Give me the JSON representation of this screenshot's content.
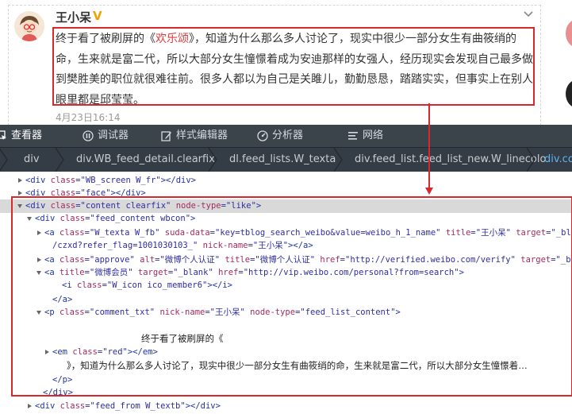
{
  "feed": {
    "username": "王小呆",
    "v_badge": "V",
    "post_prefix": "终于看了被刷屏的《",
    "post_highlight": "欢乐颂",
    "post_suffix": "》，知道为什么那么多人讨论了，现实中很少一部分女生有曲筱绡的命，生来就是富二代，所以大部分女生憧憬着成为安迪那样的女强人，经历现实会发现自己最多做到樊胜美的职位就很难往前。很多人都以为自己是关雎儿，勤勤恳恳，踏踏实实，但事实上在别人眼里都是邱莹莹。",
    "date": "4月23日16:14"
  },
  "devtools": {
    "tabs": [
      {
        "label": "查看器",
        "icon": "inspector-icon"
      },
      {
        "label": "调试器",
        "icon": "debugger-icon"
      },
      {
        "label": "样式编辑器",
        "icon": "style-editor-icon"
      },
      {
        "label": "分析器",
        "icon": "profiler-icon"
      },
      {
        "label": "网络",
        "icon": "network-icon"
      }
    ],
    "breadcrumbs": [
      "div",
      "div.WB_feed_detail.clearfix",
      "dl.feed_lists.W_texta",
      "div.feed_list.feed_list_new.W_linecolo",
      "div.co"
    ],
    "dom": {
      "l0": {
        "tag": "div",
        "attrs": [
          [
            "class",
            "WB_screen W_fr"
          ]
        ],
        "close": "></div>"
      },
      "l1": {
        "tag": "div",
        "attrs": [
          [
            "class",
            "face"
          ]
        ],
        "close": "></div>"
      },
      "l2": {
        "tag": "div",
        "attrs": [
          [
            "class",
            "content clearfix"
          ],
          [
            "node-type",
            "like"
          ]
        ],
        "close": ">"
      },
      "l3": {
        "tag": "div",
        "attrs": [
          [
            "class",
            "feed_content wbcon"
          ]
        ],
        "close": ">"
      },
      "l4": {
        "tag": "a",
        "attrs": [
          [
            "class",
            "W_texta W_fb"
          ],
          [
            "suda-data",
            "key=tblog_search_weibo&value=weibo_h_1_name"
          ],
          [
            "title",
            "王小呆"
          ],
          [
            "target",
            "_blank"
          ]
        ],
        "close": ""
      },
      "l5": {
        "cont": "/czxd?refer_flag=1001030103_\"",
        "attrs": [
          [
            "nick-name",
            "王小呆"
          ]
        ],
        "close": "></a>"
      },
      "l6": {
        "tag": "a",
        "attrs": [
          [
            "class",
            "approve"
          ],
          [
            "alt",
            "微博个人认证"
          ],
          [
            "title",
            "微博个人认证"
          ],
          [
            "href",
            "http://verified.weibo.com/verify"
          ],
          [
            "target",
            "_bl"
          ]
        ],
        "close": ""
      },
      "l7": {
        "tag": "a",
        "attrs": [
          [
            "title",
            "微博会员"
          ],
          [
            "target",
            "_blank"
          ],
          [
            "href",
            "http://vip.weibo.com/personal?from=search"
          ]
        ],
        "close": ">"
      },
      "l8": {
        "tag": "i",
        "attrs": [
          [
            "class",
            "W_icon ico_member6"
          ]
        ],
        "close": "></i>"
      },
      "l9": {
        "closetag": "</a>"
      },
      "l10": {
        "tag": "p",
        "attrs": [
          [
            "class",
            "comment_txt"
          ],
          [
            "nick-name",
            "王小呆"
          ],
          [
            "node-type",
            "feed_list_content"
          ]
        ],
        "close": ">"
      },
      "l11": {
        "text": "终于看了被刷屏的《"
      },
      "l12": {
        "tag": "em",
        "attrs": [
          [
            "class",
            "red"
          ]
        ],
        "close": "></em>"
      },
      "l13": {
        "text": "》，知道为什么那么多人讨论了，现实中很少一部分女生有曲筱绡的命，生来就是富二代，所以大部分女生憧憬着…"
      },
      "l14": {
        "closetag": "</p>"
      },
      "l15": {
        "closetag": "</div>"
      },
      "l16": {
        "tag": "div",
        "attrs": [
          [
            "class",
            "feed_from W_textb"
          ]
        ],
        "close": "></div>"
      }
    }
  },
  "colors": {
    "highlight_red": "#d9272e",
    "link_red": "#e4393c",
    "toolbar": "#3b434b",
    "breadcrumb_active": "#5fb3f0"
  }
}
